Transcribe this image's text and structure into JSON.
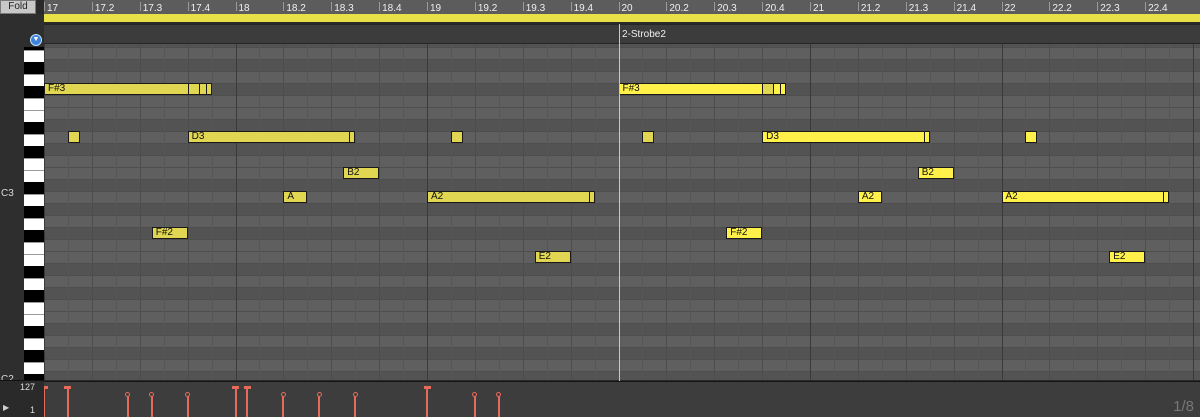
{
  "fold_button": "Fold",
  "clip_name": "2-Strobe2",
  "keyboard_labels": {
    "c3": "C3",
    "c2": "C2"
  },
  "ruler_labels": [
    "17",
    "17.2",
    "17.3",
    "17.4",
    "18",
    "18.2",
    "18.3",
    "18.4",
    "19",
    "19.2",
    "19.3",
    "19.4",
    "20",
    "20.2",
    "20.3",
    "20.4",
    "21",
    "21.2",
    "21.3",
    "21.4",
    "22",
    "22.2",
    "22.3",
    "22.4"
  ],
  "velocity_range": {
    "max": "127",
    "min": "1"
  },
  "zoom_label": "1/8",
  "colors": {
    "note": "#e0d652",
    "note_selected": "#fff14a",
    "velocity": "#e86a5a",
    "loop_bar": "#e8e047"
  },
  "notes": [
    {
      "label": "F#3",
      "pitch": "F#3",
      "start": 17.0,
      "length": 0.875,
      "selected": false
    },
    {
      "label": "",
      "pitch": "F#3",
      "start": 17.75,
      "length": 0.0625,
      "selected": false
    },
    {
      "label": "",
      "pitch": "D3",
      "start": 17.125,
      "length": 0.0625,
      "selected": false
    },
    {
      "label": "D3",
      "pitch": "D3",
      "start": 17.75,
      "length": 0.875,
      "selected": false
    },
    {
      "label": "B2",
      "pitch": "B2",
      "start": 18.5625,
      "length": 0.1875,
      "selected": false
    },
    {
      "label": "A",
      "pitch": "A2",
      "start": 18.25,
      "length": 0.125,
      "selected": false
    },
    {
      "label": "A2",
      "pitch": "A2",
      "start": 19.0,
      "length": 0.875,
      "selected": false
    },
    {
      "label": "",
      "pitch": "D3",
      "start": 19.125,
      "length": 0.0625,
      "selected": false
    },
    {
      "label": "F#2",
      "pitch": "F#2",
      "start": 17.5625,
      "length": 0.1875,
      "selected": false
    },
    {
      "label": "E2",
      "pitch": "E2",
      "start": 19.5625,
      "length": 0.1875,
      "selected": false
    },
    {
      "label": "F#3",
      "pitch": "F#3",
      "start": 20.0,
      "length": 0.875,
      "selected": true
    },
    {
      "label": "",
      "pitch": "F#3",
      "start": 20.75,
      "length": 0.0625,
      "selected": false
    },
    {
      "label": "",
      "pitch": "D3",
      "start": 20.125,
      "length": 0.0625,
      "selected": false
    },
    {
      "label": "D3",
      "pitch": "D3",
      "start": 20.75,
      "length": 0.875,
      "selected": true
    },
    {
      "label": "B2",
      "pitch": "B2",
      "start": 21.5625,
      "length": 0.1875,
      "selected": true
    },
    {
      "label": "A2",
      "pitch": "A2",
      "start": 21.25,
      "length": 0.125,
      "selected": true
    },
    {
      "label": "A2",
      "pitch": "A2",
      "start": 22.0,
      "length": 0.875,
      "selected": true
    },
    {
      "label": "",
      "pitch": "D3",
      "start": 22.125,
      "length": 0.0625,
      "selected": true
    },
    {
      "label": "F#2",
      "pitch": "F#2",
      "start": 20.5625,
      "length": 0.1875,
      "selected": true
    },
    {
      "label": "E2",
      "pitch": "E2",
      "start": 22.5625,
      "length": 0.1875,
      "selected": true
    }
  ],
  "velocities": [
    {
      "beat": 17.0,
      "value": 127
    },
    {
      "beat": 17.125,
      "value": 127
    },
    {
      "beat": 17.4375,
      "value": 100
    },
    {
      "beat": 17.5625,
      "value": 100
    },
    {
      "beat": 17.75,
      "value": 100
    },
    {
      "beat": 18.0,
      "value": 127
    },
    {
      "beat": 18.0625,
      "value": 127
    },
    {
      "beat": 18.25,
      "value": 100
    },
    {
      "beat": 18.4375,
      "value": 100
    },
    {
      "beat": 18.625,
      "value": 100
    },
    {
      "beat": 19.0,
      "value": 127
    },
    {
      "beat": 19.25,
      "value": 100
    },
    {
      "beat": 19.375,
      "value": 100
    }
  ]
}
